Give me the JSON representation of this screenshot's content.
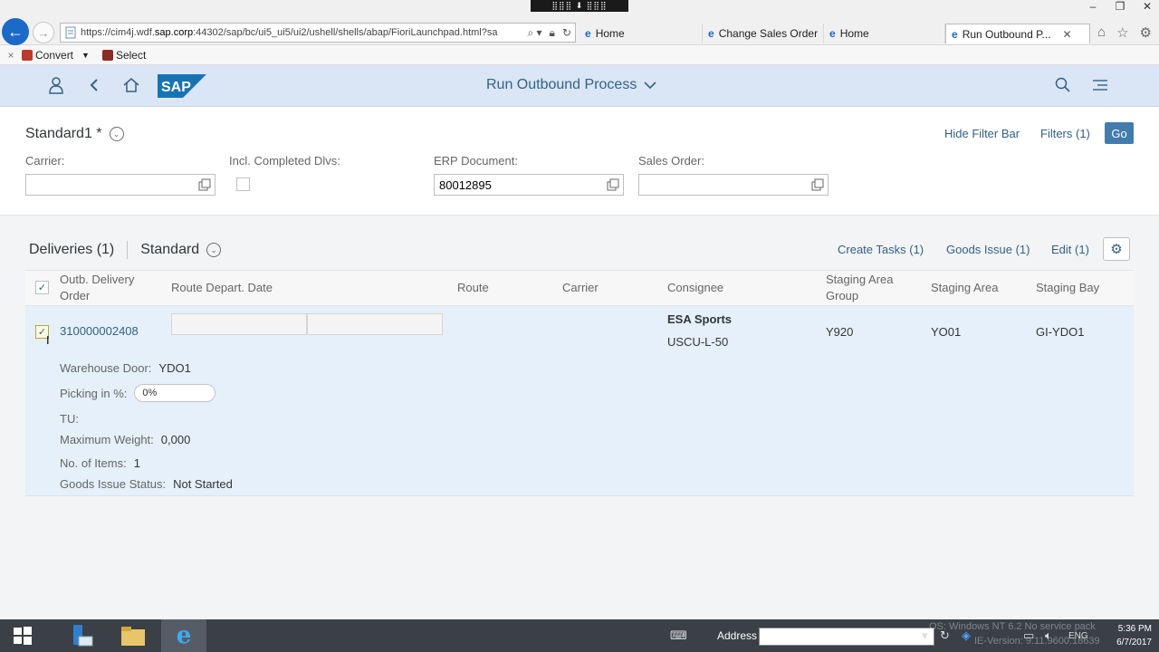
{
  "browser": {
    "url_prefix": "https://cim4j.wdf.",
    "url_host": "sap.corp",
    "url_rest": ":44302/sap/bc/ui5_ui5/ui2/ushell/shells/abap/FioriLaunchpad.html?sa",
    "tabs": [
      {
        "label": "Home"
      },
      {
        "label": "Change Sales Order"
      },
      {
        "label": "Home"
      },
      {
        "label": "Run Outbound P..."
      }
    ],
    "top_badge": "⣿⣿⣿ ⬇ ⣿⣿⣿"
  },
  "commandbar": {
    "close": "×",
    "convert_label": "Convert",
    "select_label": "Select"
  },
  "shell": {
    "logo_text": "SAP",
    "title": "Run Outbound Process"
  },
  "filterbar": {
    "variant": "Standard1 *",
    "hide_filter_bar": "Hide Filter Bar",
    "filters": "Filters (1)",
    "go": "Go",
    "fields": {
      "carrier_label": "Carrier:",
      "carrier_value": "",
      "incl_completed_label": "Incl. Completed Dlvs:",
      "erp_document_label": "ERP Document:",
      "erp_document_value": "80012895",
      "sales_order_label": "Sales Order:",
      "sales_order_value": ""
    }
  },
  "table": {
    "title": "Deliveries (1)",
    "variant": "Standard",
    "actions": {
      "create_tasks": "Create Tasks (1)",
      "goods_issue": "Goods Issue (1)",
      "edit": "Edit (1)"
    },
    "columns": {
      "outb_delivery_order_l1": "Outb. Delivery",
      "outb_delivery_order_l2": "Order",
      "route_depart_date": "Route Depart. Date",
      "route": "Route",
      "carrier": "Carrier",
      "consignee": "Consignee",
      "staging_area_group_l1": "Staging Area",
      "staging_area_group_l2": "Group",
      "staging_area": "Staging Area",
      "staging_bay": "Staging Bay"
    },
    "row": {
      "order": "310000002408",
      "consignee_name": "ESA Sports",
      "consignee_id": "USCU-L-50",
      "staging_area_group": "Y920",
      "staging_area": "YO01",
      "staging_bay": "GI-YDO1",
      "details": {
        "warehouse_door_label": "Warehouse Door:",
        "warehouse_door_value": "YDO1",
        "picking_label": "Picking in %:",
        "picking_value": "0%",
        "picking_fraction": 0,
        "tu_label": "TU:",
        "max_weight_label": "Maximum Weight:",
        "max_weight_value": "0,000",
        "items_label": "No. of Items:",
        "items_value": "1",
        "gi_status_label": "Goods Issue Status:",
        "gi_status_value": "Not Started"
      }
    }
  },
  "taskbar": {
    "address_label": "Address",
    "lang": "ENG",
    "time": "5:36 PM",
    "date": "6/7/2017",
    "ghost_line1": "OS: Windows NT 6.2 No service pack",
    "ghost_line2": "IE-Version: 9.11.9600.18639"
  },
  "colors": {
    "shell_bg": "#dae6f5",
    "accent": "#346187",
    "go_button": "#427cac",
    "selected_row": "#e5f0fa"
  }
}
